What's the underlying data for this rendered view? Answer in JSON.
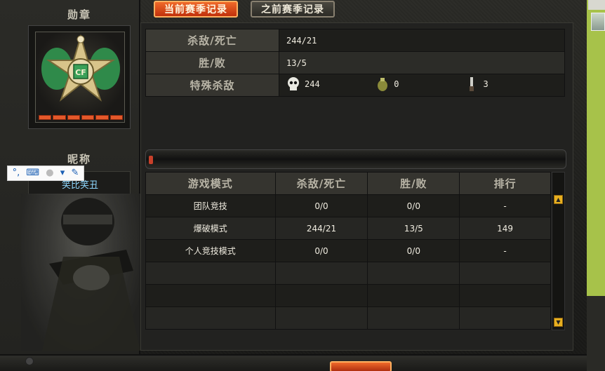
{
  "left": {
    "medal_title": "勋章",
    "nick_title": "昵称",
    "nickname": "笑比笑丑"
  },
  "tabs": {
    "current": "当前赛季记录",
    "previous": "之前赛季记录"
  },
  "stats": {
    "kd_label": "杀敌/死亡",
    "kd_value": "244/21",
    "wl_label": "胜/败",
    "wl_value": "13/5",
    "special_label": "特殊杀敌",
    "special_kills": [
      {
        "icon": "skull-icon",
        "value": "244"
      },
      {
        "icon": "grenade-icon",
        "value": "0"
      },
      {
        "icon": "knife-icon",
        "value": "3"
      }
    ]
  },
  "mode_table": {
    "headers": [
      "游戏模式",
      "杀敌/死亡",
      "胜/败",
      "排行"
    ],
    "rows": [
      [
        "团队竞技",
        "0/0",
        "0/0",
        "-"
      ],
      [
        "爆破模式",
        "244/21",
        "13/5",
        "149"
      ],
      [
        "个人竞技模式",
        "0/0",
        "0/0",
        "-"
      ],
      [
        "",
        "",
        "",
        ""
      ],
      [
        "",
        "",
        "",
        ""
      ],
      [
        "",
        "",
        "",
        ""
      ]
    ]
  },
  "toolbar_icons": [
    "input-method-icon",
    "keyboard-icon",
    "user-icon",
    "shirt-icon",
    "wrench-icon"
  ],
  "colors": {
    "accent": "#e05020",
    "nickname": "#8fd8ff",
    "side_panel": "#a7c24a"
  }
}
